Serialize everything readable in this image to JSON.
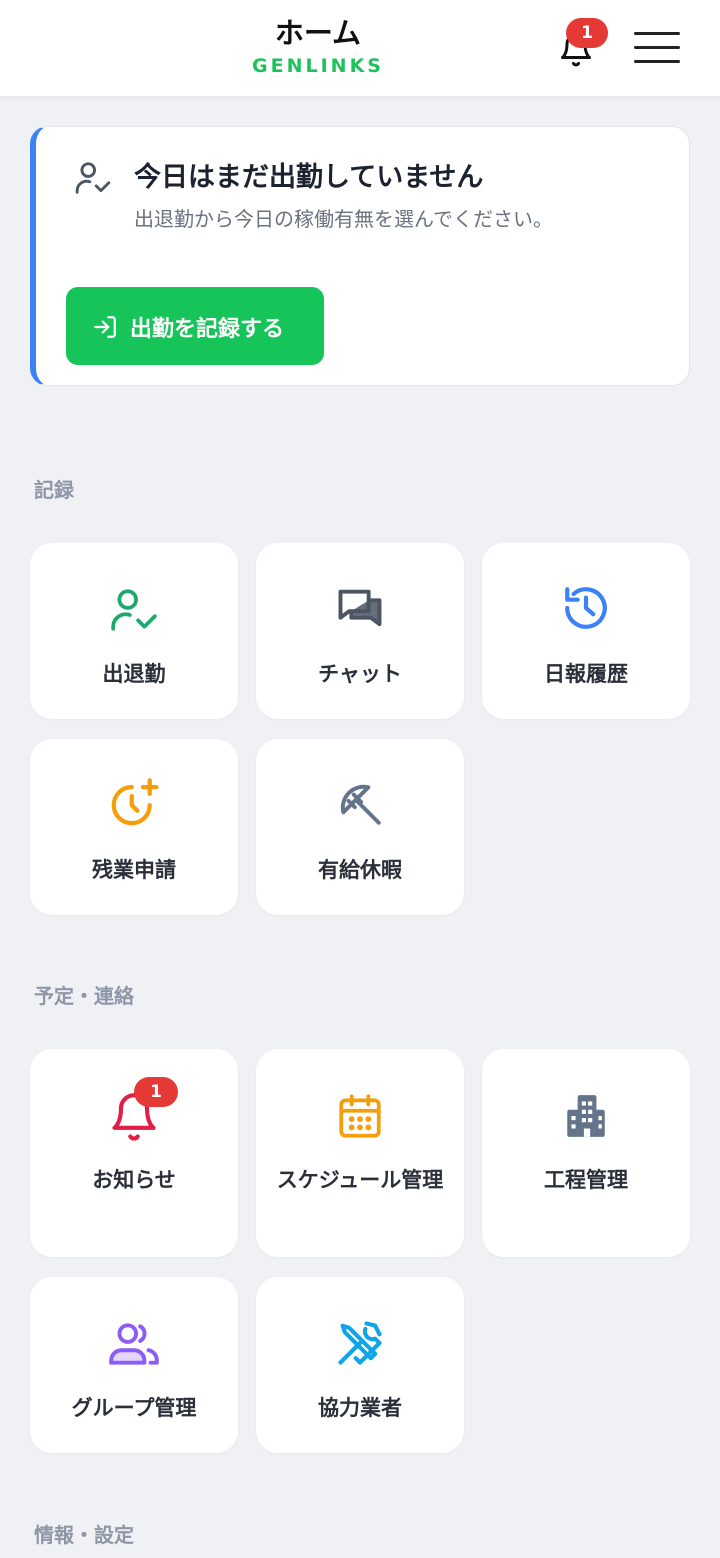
{
  "header": {
    "title": "ホーム",
    "brand": "GENLINKS",
    "notification_count": "1",
    "brand_color": "#1ec25a"
  },
  "attendance": {
    "title": "今日はまだ出勤していません",
    "subtitle": "出退勤から今日の稼働有無を選んでください。",
    "button_label": "出勤を記録する",
    "accent_color": "#3b82f6",
    "button_color": "#16c45a"
  },
  "sections": {
    "record": {
      "heading": "記録",
      "items": [
        {
          "label": "出退勤",
          "icon": "user-check-icon",
          "color": "#1fa86b"
        },
        {
          "label": "チャット",
          "icon": "chat-icon",
          "color": "#4b5563"
        },
        {
          "label": "日報履歴",
          "icon": "history-icon",
          "color": "#3b82f6"
        },
        {
          "label": "残業申請",
          "icon": "clock-plus-icon",
          "color": "#f59e0b"
        },
        {
          "label": "有給休暇",
          "icon": "umbrella-icon",
          "color": "#64748b"
        }
      ]
    },
    "schedule": {
      "heading": "予定・連絡",
      "items": [
        {
          "label": "お知らせ",
          "icon": "bell-icon",
          "color": "#e11d48",
          "badge": "1"
        },
        {
          "label": "スケジュール管理",
          "icon": "calendar-icon",
          "color": "#f59e0b"
        },
        {
          "label": "工程管理",
          "icon": "building-icon",
          "color": "#64748b"
        },
        {
          "label": "グループ管理",
          "icon": "users-icon",
          "color": "#8b5cf6"
        },
        {
          "label": "協力業者",
          "icon": "tools-icon",
          "color": "#0ea5e9"
        }
      ]
    },
    "info": {
      "heading": "情報・設定"
    }
  }
}
